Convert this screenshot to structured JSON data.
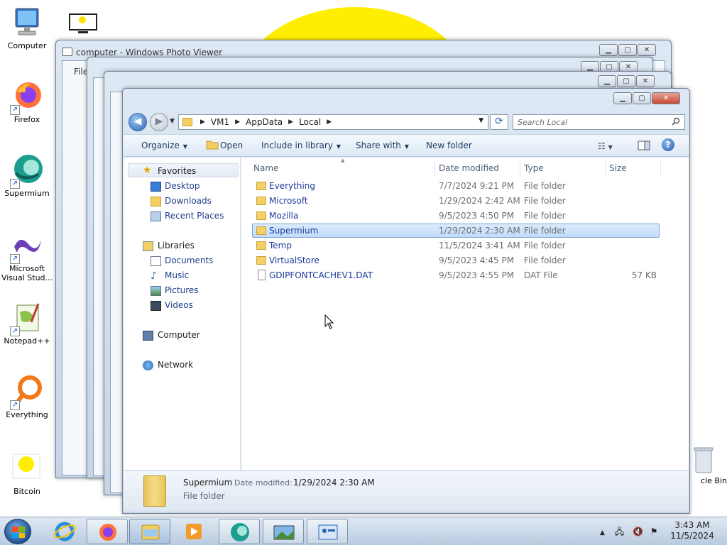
{
  "desktop": {
    "icons": [
      {
        "label": "Computer"
      },
      {
        "label": "Firefox"
      },
      {
        "label": "Supermium"
      },
      {
        "label": "Microsoft Visual Stud..."
      },
      {
        "label": "Notepad++"
      },
      {
        "label": "Everything"
      },
      {
        "label": "Bitcoin"
      }
    ],
    "recycle_label": "cle Bin"
  },
  "background_windows": {
    "photo_viewer_title": "computer - Windows Photo Viewer",
    "photo_viewer_menu": "File"
  },
  "explorer": {
    "breadcrumbs": [
      "VM1",
      "AppData",
      "Local"
    ],
    "search_placeholder": "Search Local",
    "toolbar": {
      "organize": "Organize",
      "open": "Open",
      "include_in_library": "Include in library",
      "share_with": "Share with",
      "new_folder": "New folder"
    },
    "nav": {
      "favorites": "Favorites",
      "desktop": "Desktop",
      "downloads": "Downloads",
      "recent_places": "Recent Places",
      "libraries": "Libraries",
      "documents": "Documents",
      "music": "Music",
      "pictures": "Pictures",
      "videos": "Videos",
      "computer": "Computer",
      "network": "Network"
    },
    "columns": {
      "name": "Name",
      "date_modified": "Date modified",
      "type": "Type",
      "size": "Size"
    },
    "files": [
      {
        "name": "Everything",
        "date": "7/7/2024 9:21 PM",
        "type": "File folder",
        "size": "",
        "selected": false,
        "kind": "folder"
      },
      {
        "name": "Microsoft",
        "date": "1/29/2024 2:42 AM",
        "type": "File folder",
        "size": "",
        "selected": false,
        "kind": "folder"
      },
      {
        "name": "Mozilla",
        "date": "9/5/2023 4:50 PM",
        "type": "File folder",
        "size": "",
        "selected": false,
        "kind": "folder"
      },
      {
        "name": "Supermium",
        "date": "1/29/2024 2:30 AM",
        "type": "File folder",
        "size": "",
        "selected": true,
        "kind": "folder"
      },
      {
        "name": "Temp",
        "date": "11/5/2024 3:41 AM",
        "type": "File folder",
        "size": "",
        "selected": false,
        "kind": "folder"
      },
      {
        "name": "VirtualStore",
        "date": "9/5/2023 4:45 PM",
        "type": "File folder",
        "size": "",
        "selected": false,
        "kind": "folder"
      },
      {
        "name": "GDIPFONTCACHEV1.DAT",
        "date": "9/5/2023 4:55 PM",
        "type": "DAT File",
        "size": "57 KB",
        "selected": false,
        "kind": "file"
      }
    ],
    "details": {
      "name": "Supermium",
      "date_label": "Date modified:",
      "date_value": "1/29/2024 2:30 AM",
      "type": "File folder"
    }
  },
  "taskbar": {
    "time": "3:43 AM",
    "date": "11/5/2024"
  },
  "colors": {
    "sun": "#ffee00",
    "selection": "#c1dcfc",
    "link_text": "#1a3a9a"
  }
}
